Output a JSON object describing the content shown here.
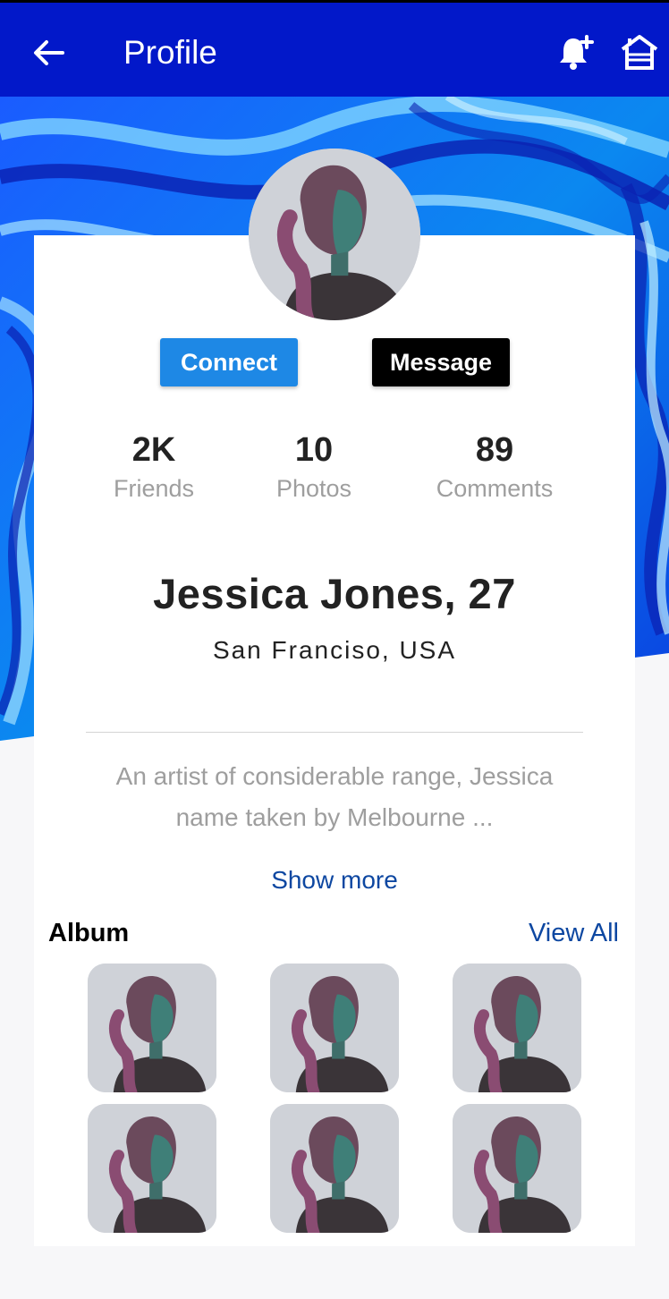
{
  "appbar": {
    "title": "Profile",
    "back_icon": "arrow-back-icon",
    "notification_icon": "bell-plus-icon",
    "home_icon": "home-icon",
    "bg_color": "#0218c9"
  },
  "profile": {
    "name": "Jessica Jones, 27",
    "location": "San Franciso, USA",
    "bio": "An artist of considerable range, Jessica name taken by Melbourne ...",
    "show_more": "Show more"
  },
  "actions": {
    "connect": "Connect",
    "message": "Message",
    "connect_color": "#1e88e5",
    "message_color": "#000000"
  },
  "stats": [
    {
      "value": "2K",
      "label": "Friends"
    },
    {
      "value": "10",
      "label": "Photos"
    },
    {
      "value": "89",
      "label": "Comments"
    }
  ],
  "album": {
    "title": "Album",
    "view_all": "View All",
    "photo_count": 6
  },
  "colors": {
    "accent_link": "#0d47a1",
    "muted_text": "#9e9e9e"
  }
}
